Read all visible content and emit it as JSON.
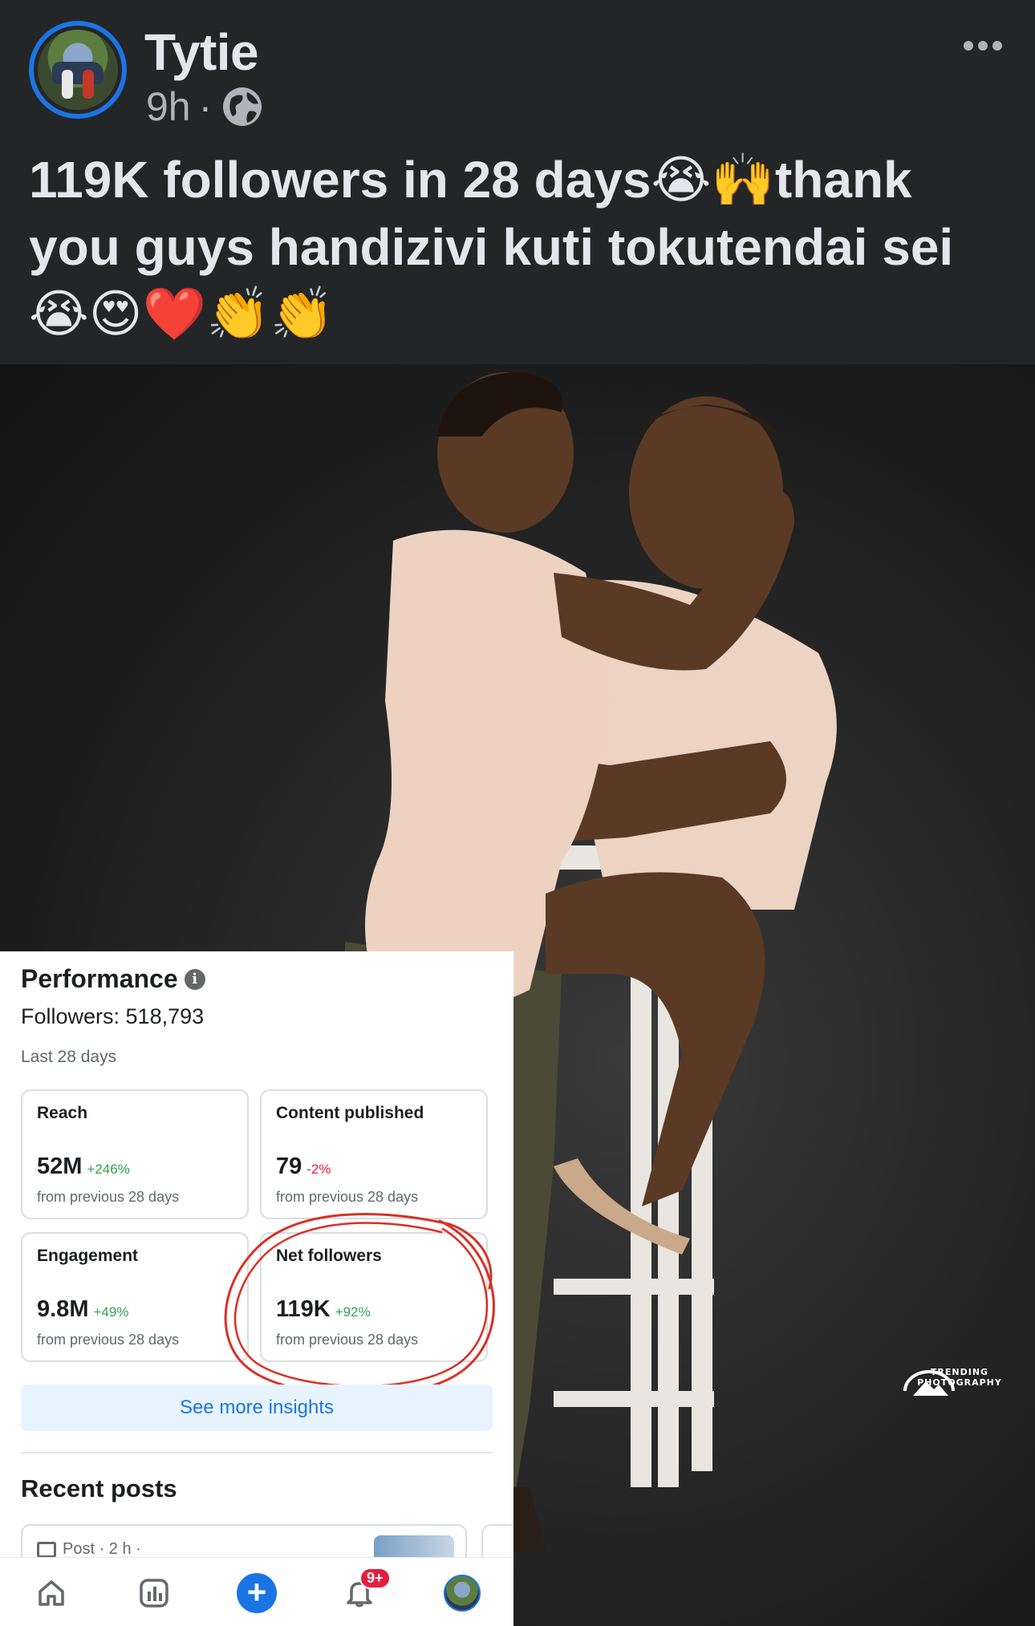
{
  "post": {
    "author": "Tytie",
    "time": "9h",
    "separator": "·",
    "text_line1": "119K followers in 28 days😭🙌thank",
    "text_line2": "you guys handizivi kuti tokutendai sei",
    "text_line3": "😭😍❤️👏👏"
  },
  "photo": {
    "watermark": "TRENDING PHOTOGRAPHY"
  },
  "insights": {
    "title": "Performance",
    "info_glyph": "i",
    "followers": "Followers: 518,793",
    "period": "Last 28 days",
    "metrics": [
      {
        "label": "Reach",
        "value": "52M",
        "change": "+246%",
        "sub": "from previous 28 days"
      },
      {
        "label": "Content published",
        "value": "79",
        "change": "-2%",
        "sub": "from previous 28 days"
      },
      {
        "label": "Engagement",
        "value": "9.8M",
        "change": "+49%",
        "sub": "from previous 28 days"
      },
      {
        "label": "Net followers",
        "value": "119K",
        "change": "+92%",
        "sub": "from previous 28 days"
      }
    ],
    "see_more": "See more insights",
    "recent_title": "Recent posts",
    "recent_post_meta": "Post · 2 h ·",
    "notifications_badge": "9+"
  },
  "colors": {
    "background": "#242526",
    "accent": "#1b74e4",
    "positive": "#31a24c",
    "negative": "#e41e3f",
    "annotation": "#d93025"
  },
  "icons": [
    "more-icon",
    "globe-icon",
    "info-icon",
    "home-icon",
    "dashboard-icon",
    "create-icon",
    "bell-icon",
    "profile-avatar"
  ]
}
